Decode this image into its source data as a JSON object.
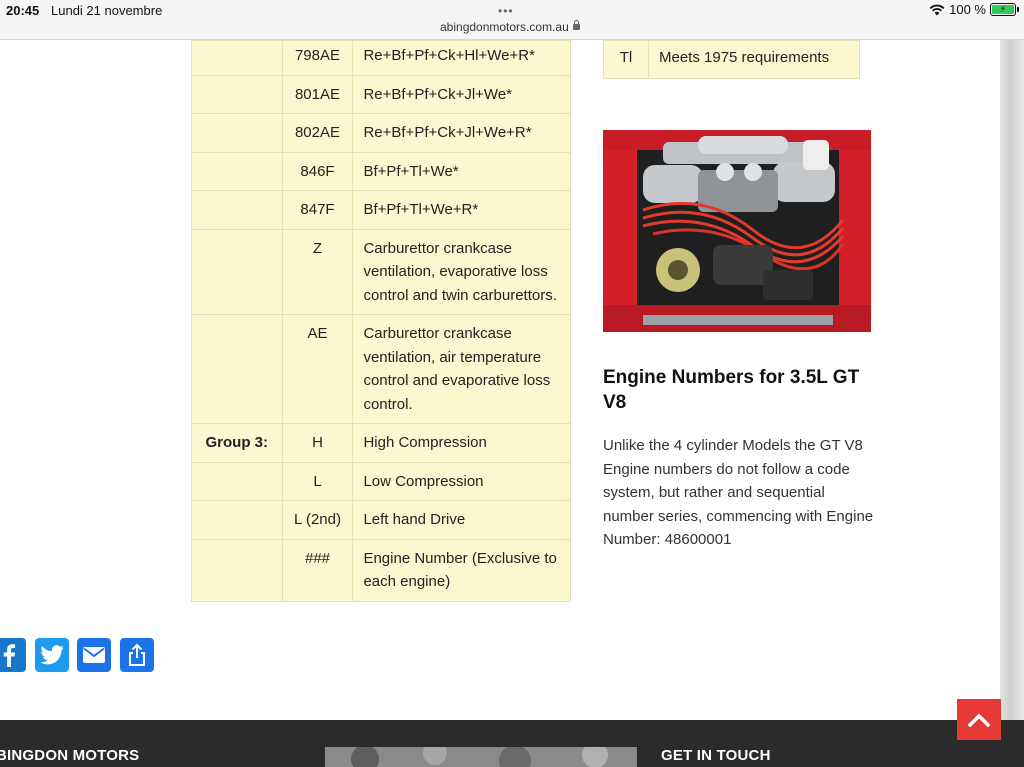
{
  "status_bar": {
    "time": "20:45",
    "date": "Lundi 21 novembre",
    "url": "abingdonmotors.com.au",
    "battery": "100 %"
  },
  "spec_table": {
    "rows": [
      {
        "group": "",
        "code": "798AE",
        "desc": "Re+Bf+Pf+Ck+Hl+We+R*"
      },
      {
        "group": "",
        "code": "801AE",
        "desc": "Re+Bf+Pf+Ck+Jl+We*"
      },
      {
        "group": "",
        "code": "802AE",
        "desc": "Re+Bf+Pf+Ck+Jl+We+R*"
      },
      {
        "group": "",
        "code": "846F",
        "desc": "Bf+Pf+Tl+We*"
      },
      {
        "group": "",
        "code": "847F",
        "desc": "Bf+Pf+Tl+We+R*"
      },
      {
        "group": "",
        "code": "Z",
        "desc": "Carburettor crankcase ventilation, evaporative loss control and twin carburettors."
      },
      {
        "group": "",
        "code": "AE",
        "desc": "Carburettor crankcase ventilation, air temperature control and evaporative loss control."
      },
      {
        "group": "Group 3:",
        "code": "H",
        "desc": "High Compression"
      },
      {
        "group": "",
        "code": "L",
        "desc": "Low Compression"
      },
      {
        "group": "",
        "code": "L (2nd)",
        "desc": "Left hand Drive"
      },
      {
        "group": "",
        "code": "###",
        "desc": "Engine Number  (Exclusive to each engine)"
      }
    ]
  },
  "small_table": {
    "code": "Tl",
    "desc": "Meets 1975 requirements"
  },
  "engine_section": {
    "heading": "Engine Numbers for 3.5L GT V8",
    "body": "Unlike the 4 cylinder Models the GT V8 Engine numbers do not follow a code system, but rather and sequential number series, commencing with Engine Number: 48600001"
  },
  "share": {
    "icons": [
      "facebook-icon",
      "twitter-icon",
      "email-icon",
      "share-icon"
    ]
  },
  "footer": {
    "brand": "BINGDON MOTORS",
    "contact_heading": "GET IN TOUCH"
  },
  "colors": {
    "table_bg": "#fbf8d1",
    "table_border": "#e6e1b4",
    "footer_bg": "#2b2b2b",
    "back_to_top": "#e53935",
    "facebook": "#1877c9",
    "twitter": "#1d9bf0"
  }
}
